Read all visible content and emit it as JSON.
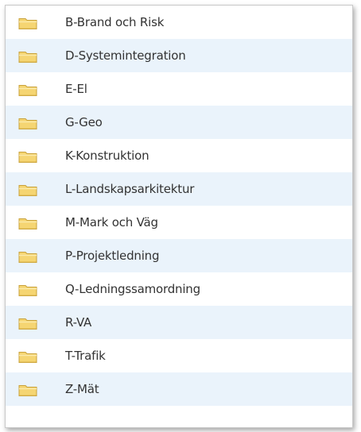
{
  "colors": {
    "row_alt_background": "#eaf3fb",
    "text": "#333333",
    "folder_body": "#f5d572",
    "folder_edge": "#c9a23b"
  },
  "folders": [
    {
      "label": "B-Brand och Risk",
      "icon": "folder-icon"
    },
    {
      "label": "D-Systemintegration",
      "icon": "folder-icon"
    },
    {
      "label": "E-El",
      "icon": "folder-icon"
    },
    {
      "label": "G-Geo",
      "icon": "folder-icon"
    },
    {
      "label": "K-Konstruktion",
      "icon": "folder-icon"
    },
    {
      "label": "L-Landskapsarkitektur",
      "icon": "folder-icon"
    },
    {
      "label": "M-Mark och Väg",
      "icon": "folder-icon"
    },
    {
      "label": "P-Projektledning",
      "icon": "folder-icon"
    },
    {
      "label": "Q-Ledningssamordning",
      "icon": "folder-icon"
    },
    {
      "label": "R-VA",
      "icon": "folder-icon"
    },
    {
      "label": "T-Trafik",
      "icon": "folder-icon"
    },
    {
      "label": "Z-Mät",
      "icon": "folder-icon"
    }
  ]
}
